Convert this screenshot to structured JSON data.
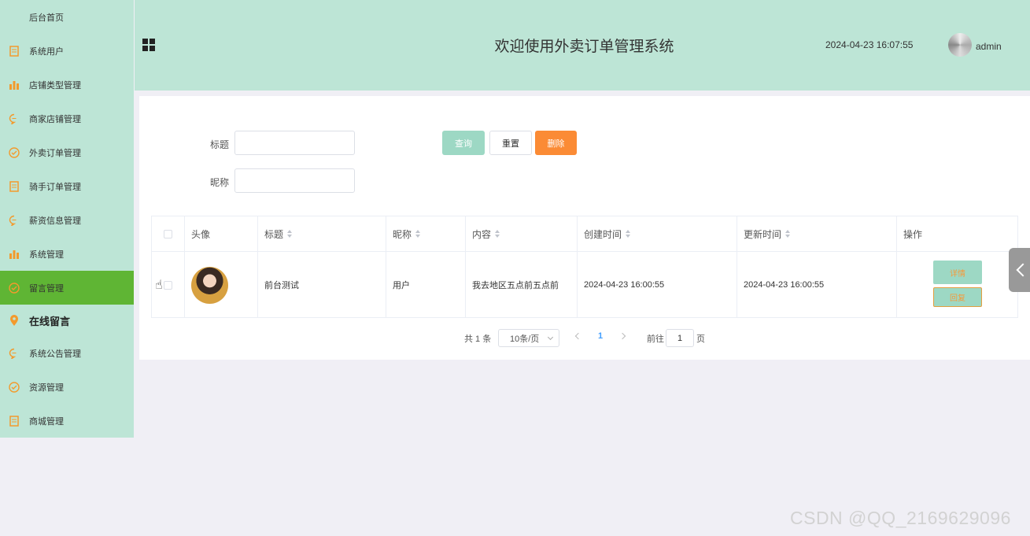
{
  "sidebar": {
    "items": [
      {
        "label": "后台首页",
        "icon": "none"
      },
      {
        "label": "系统用户",
        "icon": "document-icon"
      },
      {
        "label": "店铺类型管理",
        "icon": "bar-chart-icon"
      },
      {
        "label": "商家店铺管理",
        "icon": "chat-bubble-icon"
      },
      {
        "label": "外卖订单管理",
        "icon": "check-circle-icon"
      },
      {
        "label": "骑手订单管理",
        "icon": "document-icon"
      },
      {
        "label": "薪资信息管理",
        "icon": "chat-bubble-icon"
      },
      {
        "label": "系统管理",
        "icon": "bar-chart-icon"
      },
      {
        "label": "留言管理",
        "icon": "check-circle-icon"
      },
      {
        "label": "在线留言",
        "icon": "location-pin-icon"
      },
      {
        "label": "系统公告管理",
        "icon": "chat-bubble-icon"
      },
      {
        "label": "资源管理",
        "icon": "check-circle-icon"
      },
      {
        "label": "商城管理",
        "icon": "document-icon"
      }
    ],
    "active_index": 8
  },
  "header": {
    "title": "欢迎使用外卖订单管理系统",
    "datetime": "2024-04-23 16:07:55",
    "username": "admin"
  },
  "filters": {
    "title_label": "标题",
    "nickname_label": "昵称",
    "search_label": "查询",
    "reset_label": "重置",
    "delete_label": "删除"
  },
  "table": {
    "columns": [
      "头像",
      "标题",
      "昵称",
      "内容",
      "创建时间",
      "更新时间",
      "操作"
    ],
    "rows": [
      {
        "title": "前台测试",
        "nickname": "用户",
        "content": "我去地区五点前五点前",
        "created": "2024-04-23 16:00:55",
        "updated": "2024-04-23 16:00:55",
        "detail_label": "详情",
        "reply_label": "回复"
      }
    ]
  },
  "pagination": {
    "total_text": "共 1 条",
    "page_size": "10条/页",
    "current_page": "1",
    "goto_label": "前往",
    "goto_value": "1",
    "page_suffix": "页"
  },
  "watermark": "CSDN @QQ_2169629096",
  "colors": {
    "sidebar_bg": "#bde5d6",
    "active_bg": "#5fb534",
    "icon_color": "#f39a2c",
    "search_btn": "#9dd8c4",
    "delete_btn": "#fb8b35"
  }
}
